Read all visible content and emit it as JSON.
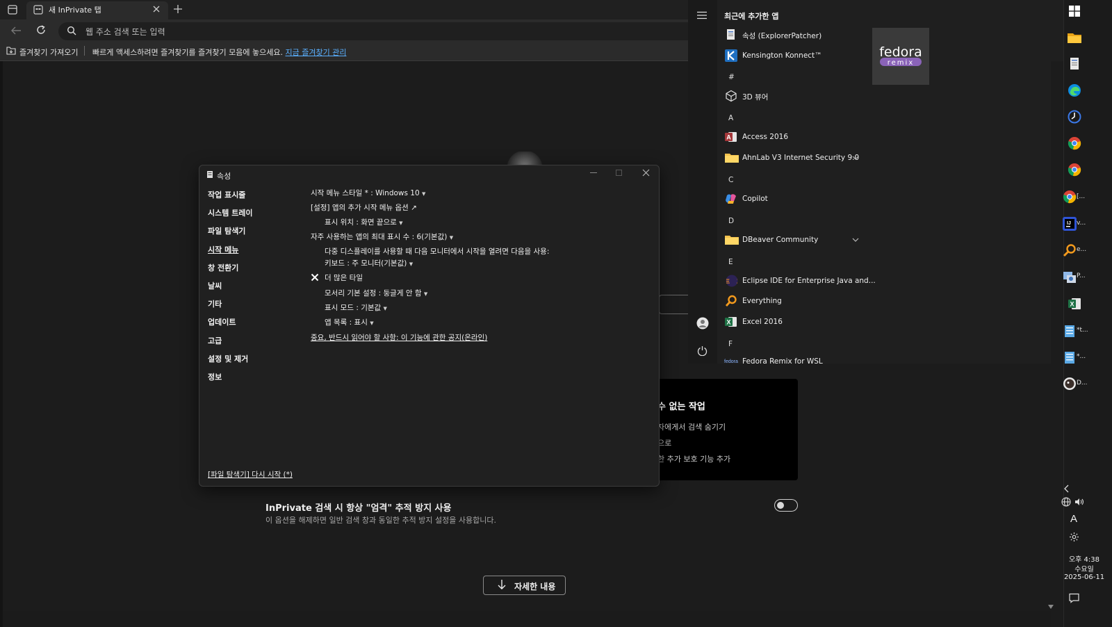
{
  "browser": {
    "tab_title": "새 InPrivate 탭",
    "address_placeholder": "웹 주소 검색 또는 입력",
    "favorites_import": "즐겨찾기 가져오기",
    "favorites_hint": "빠르게 액세스하려면 즐겨찾기를 즐겨찾기 모음에 놓으세요.",
    "favorites_link": "지금 즐겨찾기 관리"
  },
  "page": {
    "card_title": "수 없는 작업",
    "card_lines": [
      "자에게서 검색 숨기기",
      "으로",
      "한 추가 보호 기능 추가"
    ],
    "inprivate_title": "InPrivate 검색 시 항상 \"엄격\" 추적 방지 사용",
    "inprivate_desc": "이 옵션을 해제하면 일반 검색 창과 동일한 추적 방지 설정을 사용합니다.",
    "more_button": "자세한 내용"
  },
  "dialog": {
    "title": "속성",
    "nav": [
      "작업 표시줄",
      "시스템 트레이",
      "파일 탐색기",
      "시작 메뉴",
      "창 전환기",
      "날씨",
      "기타",
      "업데이트",
      "고급",
      "설정 및 제거",
      "정보"
    ],
    "selected_nav": "시작 메뉴",
    "options": {
      "style": "시작 메뉴 스타일 * : Windows 10",
      "settings_link": "[설정] 앱의 추가 시작 메뉴 옵션 ↗",
      "position": "표시 위치 : 화면 끝으로",
      "max_frequent": "자주 사용하는 앱의 최대 표시 수 : 6(기본값)",
      "multi_monitor": "다중 디스플레이를 사용할 때 다음 모니터에서 시작을 열려면 다음을 사용:",
      "keyboard": "키보드 : 주 모니터(기본값)",
      "more_tiles": "더 많은 타일",
      "corner": "모서리 기본 설정 : 둥글게 안 함",
      "display_mode": "표시 모드 : 기본값",
      "app_list": "앱 목록 : 표시",
      "notice": "중요, 반드시 읽어야 할 사항: 이 기능에 관한 공지(온라인)"
    },
    "restart": "[파일 탐색기] 다시 시작 (*)"
  },
  "startmenu": {
    "header": "최근에 추가한 앱",
    "items": [
      {
        "label": "속성 (ExplorerPatcher)",
        "icon": "properties-icon"
      },
      {
        "label": "Kensington Konnect™",
        "icon": "kensington-icon"
      },
      {
        "letter": "#"
      },
      {
        "label": "3D 뷰어",
        "icon": "cube-icon"
      },
      {
        "letter": "A"
      },
      {
        "label": "Access 2016",
        "icon": "access-icon"
      },
      {
        "label": "AhnLab V3 Internet Security 9.0",
        "icon": "folder-icon",
        "expandable": true
      },
      {
        "letter": "C"
      },
      {
        "label": "Copilot",
        "icon": "copilot-icon"
      },
      {
        "letter": "D"
      },
      {
        "label": "DBeaver Community",
        "icon": "folder-icon",
        "expandable": true
      },
      {
        "letter": "E"
      },
      {
        "label": "Eclipse IDE for Enterprise Java and...",
        "icon": "eclipse-icon"
      },
      {
        "label": "Everything",
        "icon": "magnifier-icon"
      },
      {
        "label": "Excel 2016",
        "icon": "excel-icon"
      },
      {
        "letter": "F"
      },
      {
        "label": "Fedora Remix for WSL",
        "icon": "fedora-icon"
      }
    ],
    "tile_text": "fedora",
    "tile_sub": "remix"
  },
  "taskbar": {
    "labels": [
      "[...",
      "v...",
      "e...",
      "P...",
      "*t...",
      "*...",
      "D..."
    ],
    "ime": "A",
    "time": "오후 4:38",
    "day": "수요일",
    "date": "2025-06-11"
  }
}
